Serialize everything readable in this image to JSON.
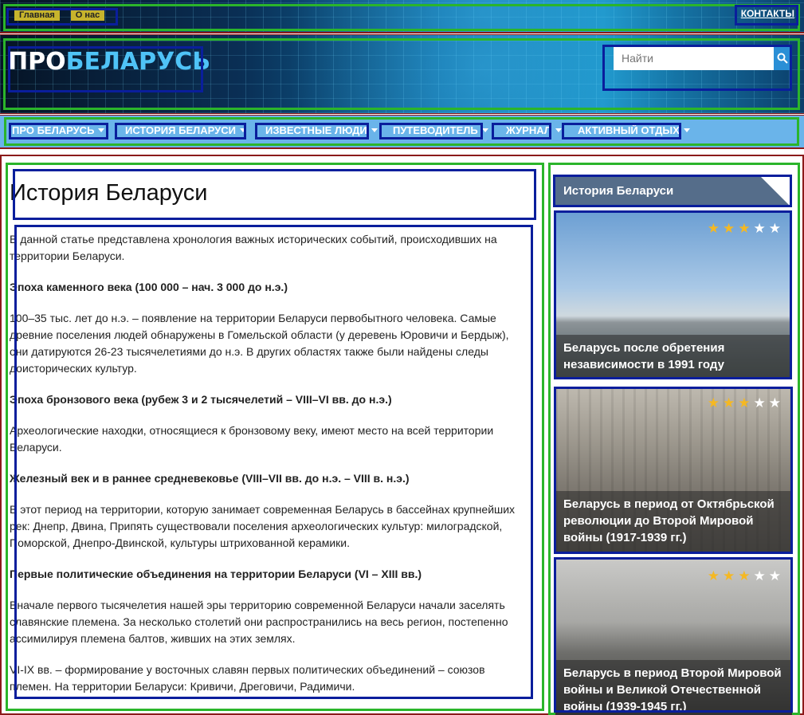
{
  "topbar": {
    "links": [
      "Главная",
      "О нас"
    ],
    "contacts": "КОНТАКТЫ"
  },
  "header": {
    "logo_pro": "ПРО",
    "logo_bel": "БЕЛАРУСЬ",
    "search_placeholder": "Найти"
  },
  "nav": {
    "items": [
      "ПРО БЕЛАРУСЬ",
      "ИСТОРИЯ БЕЛАРУСИ",
      "ИЗВЕСТНЫЕ ЛЮДИ",
      "ПУТЕВОДИТЕЛЬ",
      "ЖУРНАЛ",
      "АКТИВНЫЙ ОТДЫХ"
    ]
  },
  "article": {
    "title": "История Беларуси",
    "paragraphs": [
      {
        "bold": false,
        "text": "В данной статье представлена хронология важных исторических событий, происходивших на территории Беларуси."
      },
      {
        "bold": true,
        "text": "Эпоха каменного века (100 000 – нач. 3 000 до н.э.)"
      },
      {
        "bold": false,
        "text": "100–35 тыс. лет до н.э. – появление на территории Беларуси первобытного человека. Самые древние поселения людей обнаружены в Гомельской области (у деревень Юровичи и Бердыж), они датируются 26-23 тысячелетиями до н.э. В других областях также были найдены следы доисторических культур."
      },
      {
        "bold": true,
        "text": "Эпоха бронзового века (рубеж 3 и 2 тысячелетий – VIII–VI вв. до н.э.)"
      },
      {
        "bold": false,
        "text": "Археологические находки, относящиеся к бронзовому веку, имеют место на всей территории Беларуси."
      },
      {
        "bold": true,
        "text": "Железный век и в раннее средневековье (VIII–VII вв. до н.э. – VIII в. н.э.)"
      },
      {
        "bold": false,
        "text": "В этот период на территории, которую занимает современная Беларусь в бассейнах крупнейших рек: Днепр, Двина, Припять существовали поселения археологических культур: милоградской, Поморской, Днепро-Двинской, культуры штрихованной керамики."
      },
      {
        "bold": true,
        "text": "Первые политические объединения на территории Беларуси (VI – XIII вв.)"
      },
      {
        "bold": false,
        "text": "Вначале первого тысячелетия нашей эры территорию современной Беларуси начали заселять славянские племена. За несколько столетий они распространились на весь регион, постепенно ассимилируя племена балтов, живших на этих землях."
      },
      {
        "bold": false,
        "text": "VI-IX вв. – формирование у восточных славян первых политических объединений – союзов племен. На территории Беларуси: Кривичи, Дреговичи, Радимичи."
      }
    ]
  },
  "sidebar": {
    "heading": "История Беларуси",
    "cards": [
      {
        "title": "Беларусь после обретения независимости в 1991 году",
        "rating": 3,
        "max": 5
      },
      {
        "title": "Беларусь в период от Октябрьской революции до Второй Мировой войны (1917-1939 гг.)",
        "rating": 3,
        "max": 5
      },
      {
        "title": "Беларусь в период Второй Мировой войны и Великой Отечественной войны (1939-1945 гг.)",
        "rating": 3,
        "max": 5
      }
    ]
  },
  "colors": {
    "nav_bg": "#6ab4ea",
    "accent": "#2a8fd6",
    "star": "#f5b822",
    "widget_head": "#556d8a"
  }
}
